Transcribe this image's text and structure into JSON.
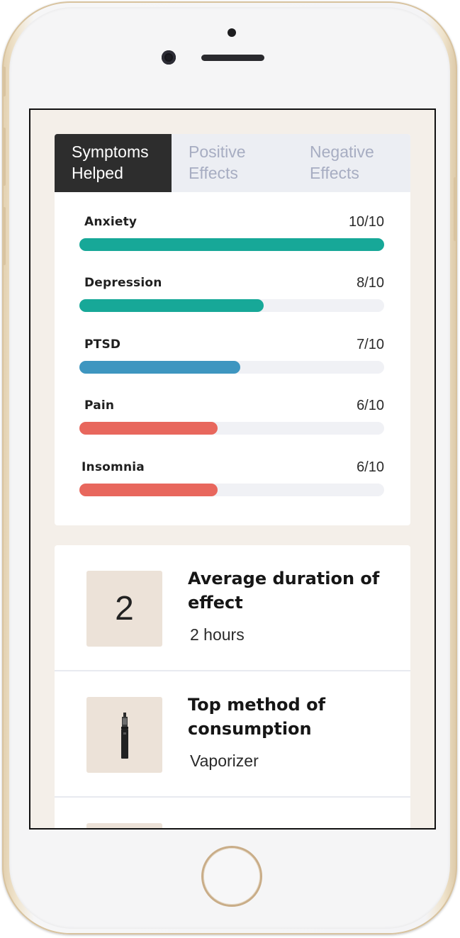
{
  "tabs": [
    {
      "line1": "Symptoms",
      "line2": "Helped",
      "active": true
    },
    {
      "line1": "Positive",
      "line2": "Effects",
      "active": false
    },
    {
      "line1": "Negative",
      "line2": "Effects",
      "active": false
    }
  ],
  "symptoms": [
    {
      "name": "Anxiety",
      "score": "10/10",
      "value": 10,
      "max": 10,
      "color": "#17a898"
    },
    {
      "name": "Depression",
      "score": "8/10",
      "value": 8,
      "max": 10,
      "color": "#17a898"
    },
    {
      "name": "PTSD",
      "score": "7/10",
      "value": 7,
      "max": 10,
      "color": "#3e96c0"
    },
    {
      "name": "Pain",
      "score": "6/10",
      "value": 6,
      "max": 10,
      "color": "#e8675d"
    },
    {
      "name": "Insomnia",
      "score": "6/10",
      "value": 6,
      "max": 10,
      "color": "#e8675d"
    }
  ],
  "info": {
    "duration": {
      "number": "2",
      "title": "Average duration of effect",
      "value": "2 hours"
    },
    "method": {
      "icon": "vaporizer-icon",
      "title": "Top method of consumption",
      "value": "Vaporizer"
    }
  }
}
